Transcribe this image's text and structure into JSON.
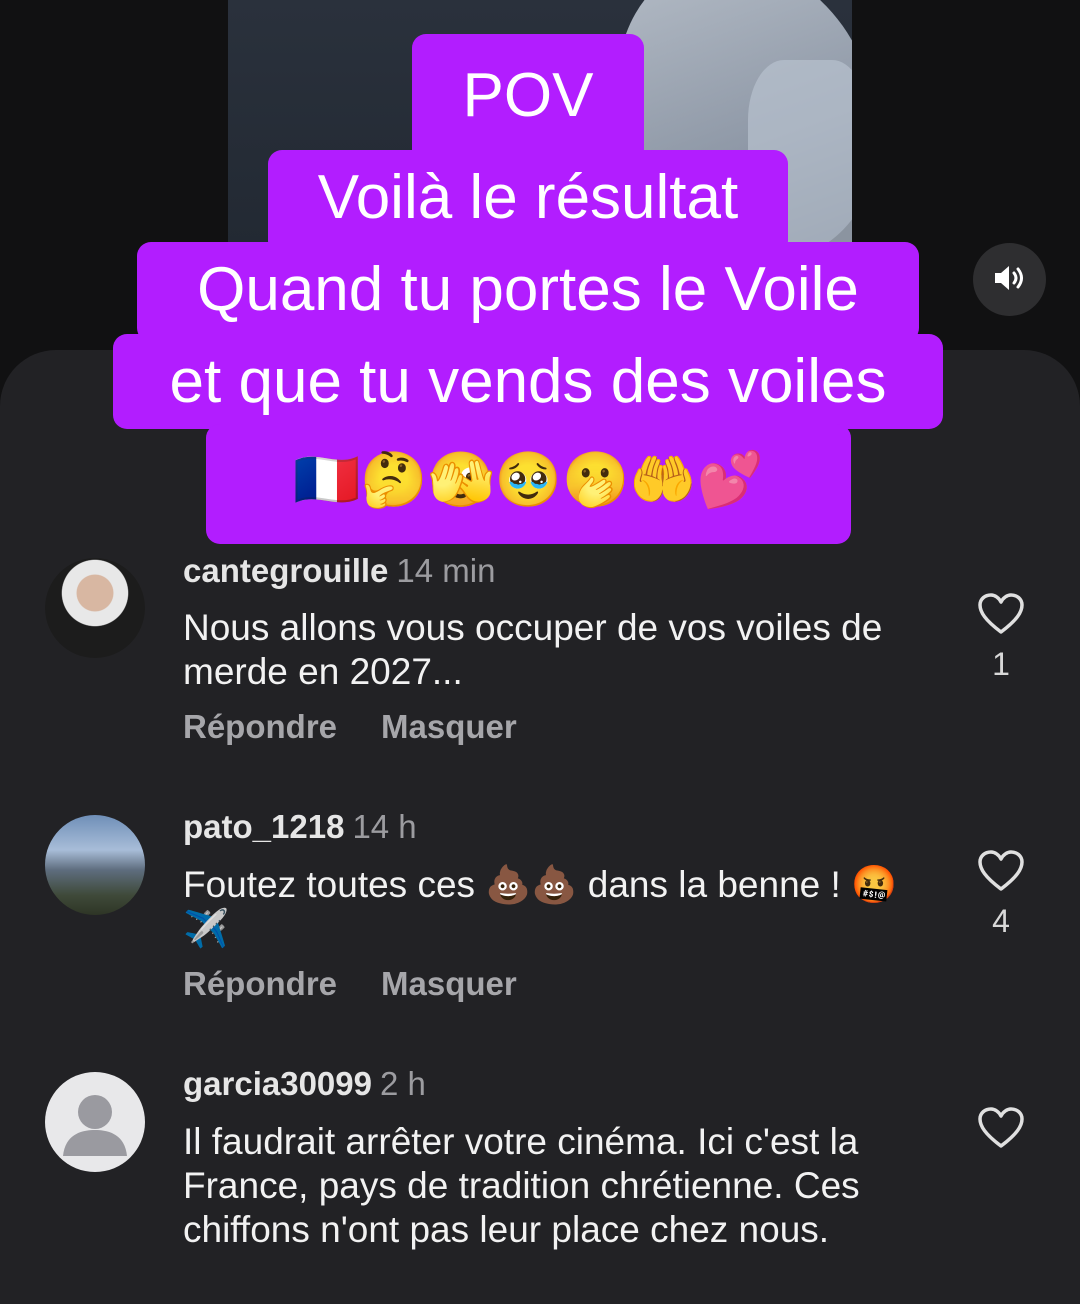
{
  "caption": {
    "line1": "POV",
    "line2": "Voilà le résultat",
    "line3": "Quand tu portes le Voile",
    "line4": "et que tu vends des voiles",
    "emojis": "🇫🇷🤔🫣🥹🫢🤲💕"
  },
  "volume": {
    "icon": "speaker-volume-icon"
  },
  "comments": [
    {
      "username": "cantegrouille",
      "time": "14 min",
      "text": "Nous allons vous occuper de vos voiles de merde en 2027...",
      "reply_label": "Répondre",
      "hide_label": "Masquer",
      "likes": "1"
    },
    {
      "username": "pato_1218",
      "time": "14 h",
      "text": "Foutez toutes ces 💩💩 dans la benne ! 🤬✈️",
      "reply_label": "Répondre",
      "hide_label": "Masquer",
      "likes": "4"
    },
    {
      "username": "garcia30099",
      "time": "2 h",
      "text": "Il faudrait arrêter votre cinéma. Ici c'est la France, pays de tradition chrétienne. Ces chiffons n'ont pas leur place chez nous.",
      "likes": ""
    }
  ]
}
